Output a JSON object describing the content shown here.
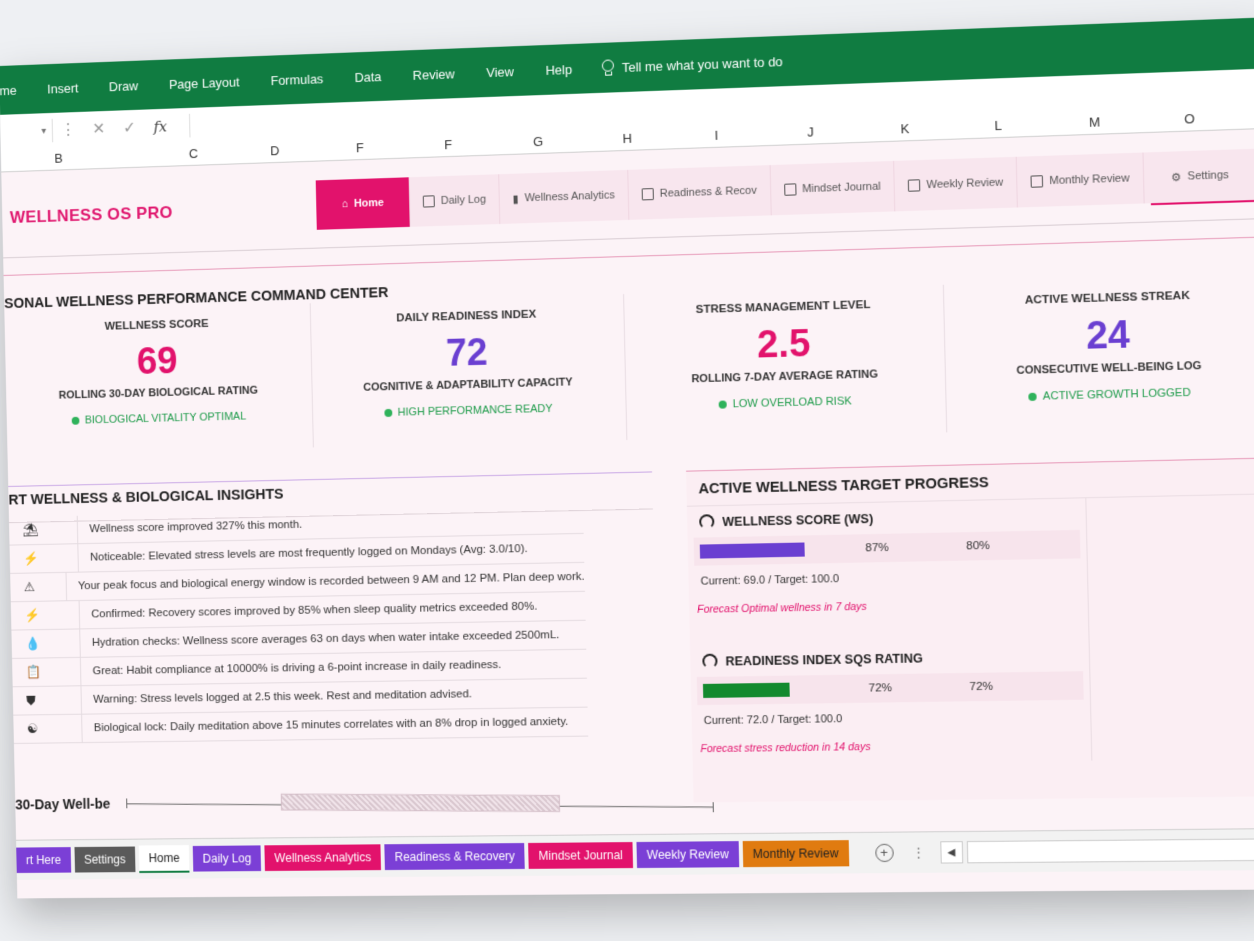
{
  "ribbon": {
    "tabs": [
      "me",
      "Insert",
      "Draw",
      "Page Layout",
      "Formulas",
      "Data",
      "Review",
      "View",
      "Help"
    ],
    "tell": "Tell me what you want to do"
  },
  "columns": [
    "B",
    "C",
    "D",
    "F",
    "F",
    "G",
    "H",
    "I",
    "J",
    "K",
    "L",
    "M",
    "O"
  ],
  "brand": "WELLNESS OS PRO",
  "nav": [
    {
      "label": "Home",
      "icon": "home-icon"
    },
    {
      "label": "Daily Log",
      "icon": "log-icon"
    },
    {
      "label": "Wellness Analytics",
      "icon": "chart-icon"
    },
    {
      "label": "Readiness & Recov",
      "icon": "grid-icon"
    },
    {
      "label": "Mindset Journal",
      "icon": "journal-icon"
    },
    {
      "label": "Weekly Review",
      "icon": "table-icon"
    },
    {
      "label": "Monthly Review",
      "icon": "calendar-icon"
    },
    {
      "label": "Settings",
      "icon": "gear-icon"
    }
  ],
  "command_center_title": "SONAL WELLNESS PERFORMANCE COMMAND CENTER",
  "kpis": [
    {
      "title": "WELLNESS SCORE",
      "value": "69",
      "sub": "ROLLING 30-DAY BIOLOGICAL RATING",
      "status": "BIOLOGICAL VITALITY OPTIMAL",
      "color": "#e2126c"
    },
    {
      "title": "DAILY READINESS INDEX",
      "value": "72",
      "sub": "COGNITIVE & ADAPTABILITY CAPACITY",
      "status": "HIGH PERFORMANCE READY",
      "color": "#6a3fd1"
    },
    {
      "title": "STRESS MANAGEMENT LEVEL",
      "value": "2.5",
      "sub": "ROLLING 7-DAY AVERAGE RATING",
      "status": "LOW OVERLOAD RISK",
      "color": "#e2126c"
    },
    {
      "title": "ACTIVE WELLNESS STREAK",
      "value": "24",
      "sub": "CONSECUTIVE WELL-BEING LOG",
      "status": "ACTIVE GROWTH LOGGED",
      "color": "#6a3fd1"
    }
  ],
  "insights_title": "RT WELLNESS & BIOLOGICAL INSIGHTS",
  "insights": [
    {
      "icon": "tree-icon",
      "glyph": "⛱",
      "text": "Wellness score improved 327% this month."
    },
    {
      "icon": "bolt-icon",
      "glyph": "⚡",
      "text": "Noticeable: Elevated stress levels are most frequently logged on Mondays (Avg: 3.0/10)."
    },
    {
      "icon": "warning-icon",
      "glyph": "⚠",
      "text": "Your peak focus and biological energy window is recorded between 9 AM and 12 PM. Plan deep work."
    },
    {
      "icon": "bolt-icon",
      "glyph": "⚡",
      "text": "Confirmed: Recovery scores improved by 85% when sleep quality metrics exceeded 80%."
    },
    {
      "icon": "drop-icon",
      "glyph": "💧",
      "text": "Hydration checks: Wellness score averages 63 on days when water intake exceeded 2500mL."
    },
    {
      "icon": "clipboard-icon",
      "glyph": "📋",
      "text": "Great: Habit compliance at 10000% is driving a 6-point increase in daily readiness."
    },
    {
      "icon": "shield-icon",
      "glyph": "⛊",
      "text": "Warning: Stress levels logged at 2.5 this week. Rest and meditation advised."
    },
    {
      "icon": "meditation-icon",
      "glyph": "☯",
      "text": "Biological lock: Daily meditation above 15 minutes correlates with an 8% drop in logged anxiety."
    }
  ],
  "targets": {
    "title": "ACTIVE WELLNESS TARGET PROGRESS",
    "items": [
      {
        "title": "WELLNESS SCORE (WS)",
        "progress": 0.87,
        "pct": "87%",
        "pct2": "80%",
        "current": "Current: 69.0 / Target: 100.0",
        "forecast": "Forecast Optimal wellness in 7 days",
        "color": "#6a3fd1"
      },
      {
        "title": "READINESS INDEX SQS RATING",
        "progress": 0.72,
        "pct": "72%",
        "pct2": "72%",
        "current": "Current: 72.0 / Target: 100.0",
        "forecast": "Forecast stress reduction in 14 days",
        "color": "#138a2e"
      }
    ]
  },
  "trend_label": "30-Day Well-be",
  "sheets": [
    {
      "label": "rt Here",
      "color": "#7b3fd6"
    },
    {
      "label": "Settings",
      "color": "#5a5a5a"
    },
    {
      "label": "Home",
      "color": "#ffffff"
    },
    {
      "label": "Daily Log",
      "color": "#7b3fd6"
    },
    {
      "label": "Wellness Analytics",
      "color": "#e2126c"
    },
    {
      "label": "Readiness & Recovery",
      "color": "#7b3fd6"
    },
    {
      "label": "Mindset Journal",
      "color": "#e2126c"
    },
    {
      "label": "Weekly Review",
      "color": "#7b3fd6"
    },
    {
      "label": "Monthly Review",
      "color": "#e07b10"
    }
  ]
}
